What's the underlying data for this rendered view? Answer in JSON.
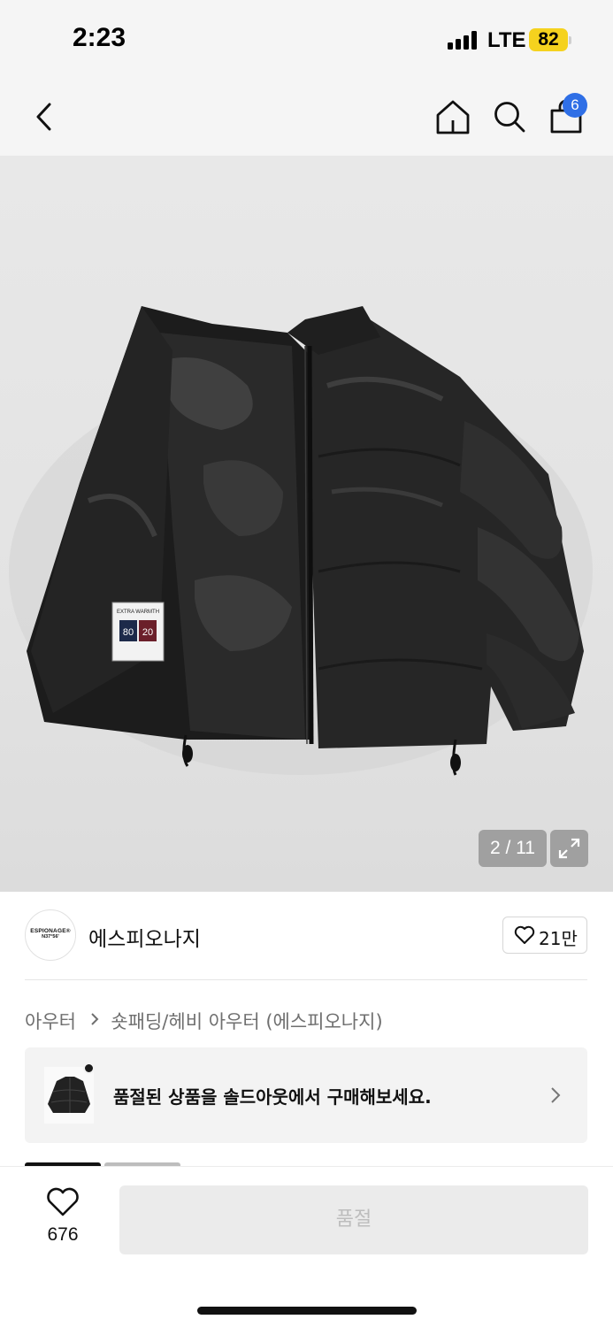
{
  "status_bar": {
    "time": "2:23",
    "network": "LTE",
    "battery": "82",
    "battery_color": "#f5d21e"
  },
  "nav": {
    "back_icon": "chevron-left-icon",
    "home_icon": "home-icon",
    "search_icon": "search-icon",
    "cart_icon": "shopping-bag-icon",
    "cart_count": "6",
    "badge_color": "#2f6fe6"
  },
  "gallery": {
    "counter": "2 / 11",
    "expand_icon": "expand-arrows-icon",
    "label_top": "EXTRA WARMTH",
    "label_left": "80",
    "label_right": "20"
  },
  "brand": {
    "logo_line1": "ESPIONAGE®",
    "logo_line2": "N37°56'",
    "name": "에스피오나지",
    "like_icon": "heart-outline-icon",
    "like_count": "21만"
  },
  "breadcrumb": {
    "items": [
      "아우터",
      "숏패딩/헤비 아우터 (에스피오나지)"
    ],
    "separator_icon": "chevron-right-icon"
  },
  "soldout_banner": {
    "text": "품절된 상품을 솔드아웃에서 구매해보세요.",
    "thumb_icon": "product-thumbnail",
    "chevron_icon": "chevron-right-icon"
  },
  "bottom_bar": {
    "wish_icon": "heart-outline-icon",
    "wish_count": "676",
    "buy_button_label": "품절"
  }
}
